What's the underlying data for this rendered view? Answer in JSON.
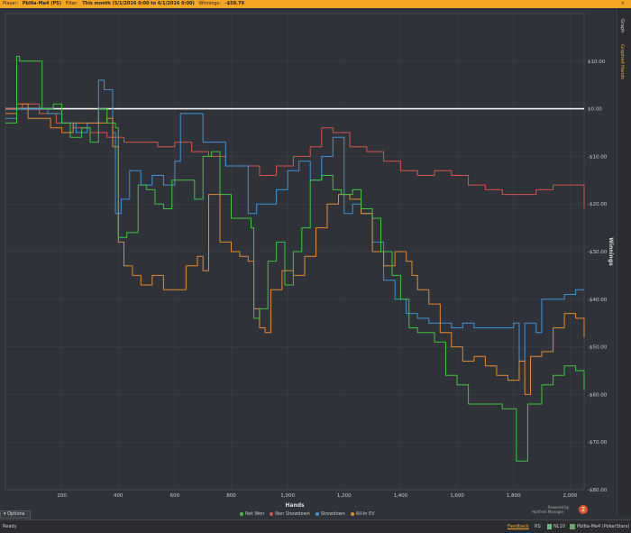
{
  "header": {
    "player_label": "Player:",
    "player_value": "Pbl6a-Me4 (PS)",
    "filter_label": "Filter:",
    "filter_value": "This month (5/1/2016 0:00 to 6/1/2016 0:00)",
    "winnings_label": "Winnings:",
    "winnings_value": "-$58.79",
    "close": "×"
  },
  "side_tabs": {
    "graph": "Graph",
    "graphed_hands": "Graphed Hands"
  },
  "footer": {
    "options": "Options",
    "ready": "Ready",
    "feedback": "Feedback",
    "flag": "RS",
    "stake": "NL10",
    "player_site": "Pbl6a-Me4 (PokerStars)",
    "powered_by": "Powered by",
    "brand": "Hold'em Manager",
    "brand_logo": "2"
  },
  "colors": {
    "net_won": "#3cc63c",
    "non_showdown": "#d9534f",
    "showdown": "#3b96d8",
    "all_in_ev": "#e8892c",
    "background": "#2f3238",
    "accent": "#f6a623"
  },
  "chart_data": {
    "type": "line",
    "title": "",
    "xlabel": "Hands",
    "ylabel": "Winnings",
    "xlim": [
      0,
      2050
    ],
    "ylim": [
      -80,
      20
    ],
    "x_ticks": [
      200,
      400,
      600,
      800,
      1000,
      1200,
      1400,
      1600,
      1800,
      2000
    ],
    "x_tick_labels": [
      "200",
      "400",
      "600",
      "800",
      "1,000",
      "1,200",
      "1,400",
      "1,600",
      "1,800",
      "2,000"
    ],
    "y_ticks": [
      10,
      0,
      -10,
      -20,
      -30,
      -40,
      -50,
      -60,
      -70,
      -80
    ],
    "y_tick_labels": [
      "$10.00",
      "$0.00",
      "-$10.00",
      "-$20.00",
      "-$30.00",
      "-$40.00",
      "-$50.00",
      "-$60.00",
      "-$70.00",
      "-$80.00"
    ],
    "grid": true,
    "legend_position": "bottom-center",
    "series": [
      {
        "name": "Net Won",
        "color": "#3cc63c",
        "x": [
          0,
          40,
          50,
          120,
          130,
          170,
          200,
          230,
          270,
          300,
          330,
          360,
          390,
          400,
          430,
          470,
          500,
          530,
          560,
          590,
          630,
          670,
          700,
          730,
          760,
          800,
          830,
          870,
          880,
          900,
          930,
          960,
          990,
          1020,
          1050,
          1080,
          1120,
          1160,
          1190,
          1230,
          1260,
          1300,
          1330,
          1370,
          1400,
          1430,
          1460,
          1490,
          1520,
          1560,
          1600,
          1640,
          1680,
          1720,
          1760,
          1800,
          1810,
          1830,
          1850,
          1870,
          1900,
          1940,
          1980,
          2020,
          2050
        ],
        "y": [
          -3,
          11,
          10,
          10,
          0,
          1,
          -3,
          -6,
          -4,
          -7,
          0,
          -3,
          -4,
          -27,
          -26,
          -16,
          -17,
          -20,
          -21,
          -15,
          -15,
          -19,
          -10,
          -9,
          -18,
          -23,
          -23,
          -25,
          -44,
          -42,
          -32,
          -28,
          -37,
          -30,
          -25,
          -15,
          -14,
          -17,
          -18,
          -17,
          -21,
          -23,
          -30,
          -35,
          -40,
          -46,
          -47,
          -47,
          -49,
          -56,
          -58,
          -62,
          -62,
          -62,
          -63,
          -63,
          -74,
          -74,
          -62,
          -62,
          -58,
          -56,
          -54,
          -55,
          -59
        ]
      },
      {
        "name": "Non Showdown",
        "color": "#d9534f",
        "x": [
          0,
          60,
          120,
          180,
          240,
          300,
          360,
          420,
          480,
          540,
          600,
          660,
          720,
          780,
          840,
          900,
          960,
          1020,
          1080,
          1120,
          1160,
          1220,
          1280,
          1340,
          1400,
          1460,
          1520,
          1580,
          1640,
          1700,
          1760,
          1820,
          1880,
          1940,
          2000,
          2050
        ],
        "y": [
          0,
          1,
          -1,
          -3,
          -4,
          -5,
          -6,
          -7,
          -7,
          -8,
          -7,
          -9,
          -10,
          -12,
          -12,
          -14,
          -12,
          -10,
          -8,
          -4,
          -5,
          -8,
          -9,
          -11,
          -13,
          -14,
          -13,
          -14,
          -16,
          -17,
          -18,
          -18,
          -17,
          -16,
          -16,
          -21
        ]
      },
      {
        "name": "Showdown",
        "color": "#3b96d8",
        "x": [
          0,
          40,
          100,
          150,
          200,
          250,
          290,
          330,
          350,
          380,
          390,
          410,
          440,
          480,
          520,
          560,
          600,
          620,
          650,
          700,
          740,
          780,
          800,
          860,
          890,
          920,
          960,
          1000,
          1040,
          1080,
          1120,
          1160,
          1200,
          1230,
          1260,
          1300,
          1340,
          1380,
          1420,
          1460,
          1500,
          1540,
          1580,
          1620,
          1660,
          1700,
          1760,
          1800,
          1820,
          1840,
          1880,
          1900,
          1940,
          1980,
          2020,
          2050
        ],
        "y": [
          -2,
          0,
          0,
          -1,
          -3,
          -5,
          -3,
          6,
          4,
          -5,
          -22,
          -19,
          -13,
          -16,
          -14,
          -16,
          -11,
          -1,
          -1,
          -7,
          -7,
          -12,
          -12,
          -22,
          -20,
          -20,
          -17,
          -13,
          -11,
          -15,
          -10,
          -6,
          -22,
          -20,
          -22,
          -28,
          -36,
          -40,
          -43,
          -44,
          -45,
          -45,
          -46,
          -45,
          -46,
          -46,
          -46,
          -45,
          -53,
          -45,
          -47,
          -40,
          -40,
          -39,
          -38,
          -38
        ]
      },
      {
        "name": "All-In EV",
        "color": "#e8892c",
        "x": [
          0,
          40,
          80,
          120,
          160,
          200,
          240,
          280,
          320,
          360,
          380,
          400,
          420,
          450,
          480,
          520,
          560,
          600,
          640,
          680,
          700,
          720,
          760,
          800,
          830,
          860,
          880,
          900,
          920,
          940,
          980,
          1020,
          1060,
          1100,
          1140,
          1180,
          1220,
          1260,
          1300,
          1340,
          1380,
          1420,
          1440,
          1460,
          1500,
          1540,
          1580,
          1620,
          1660,
          1700,
          1740,
          1780,
          1820,
          1840,
          1860,
          1900,
          1940,
          1980,
          2020,
          2050
        ],
        "y": [
          -1,
          1,
          -2,
          -2,
          -4,
          -5,
          -3,
          -3,
          -3,
          -2,
          -8,
          -28,
          -33,
          -35,
          -37,
          -35,
          -38,
          -38,
          -33,
          -31,
          -34,
          -18,
          -28,
          -30,
          -31,
          -32,
          -42,
          -46,
          -47,
          -38,
          -34,
          -35,
          -31,
          -25,
          -20,
          -18,
          -19,
          -22,
          -30,
          -33,
          -30,
          -32,
          -35,
          -38,
          -41,
          -47,
          -50,
          -53,
          -52,
          -54,
          -56,
          -57,
          -53,
          -60,
          -52,
          -51,
          -46,
          -43,
          -44,
          -48
        ]
      }
    ]
  }
}
